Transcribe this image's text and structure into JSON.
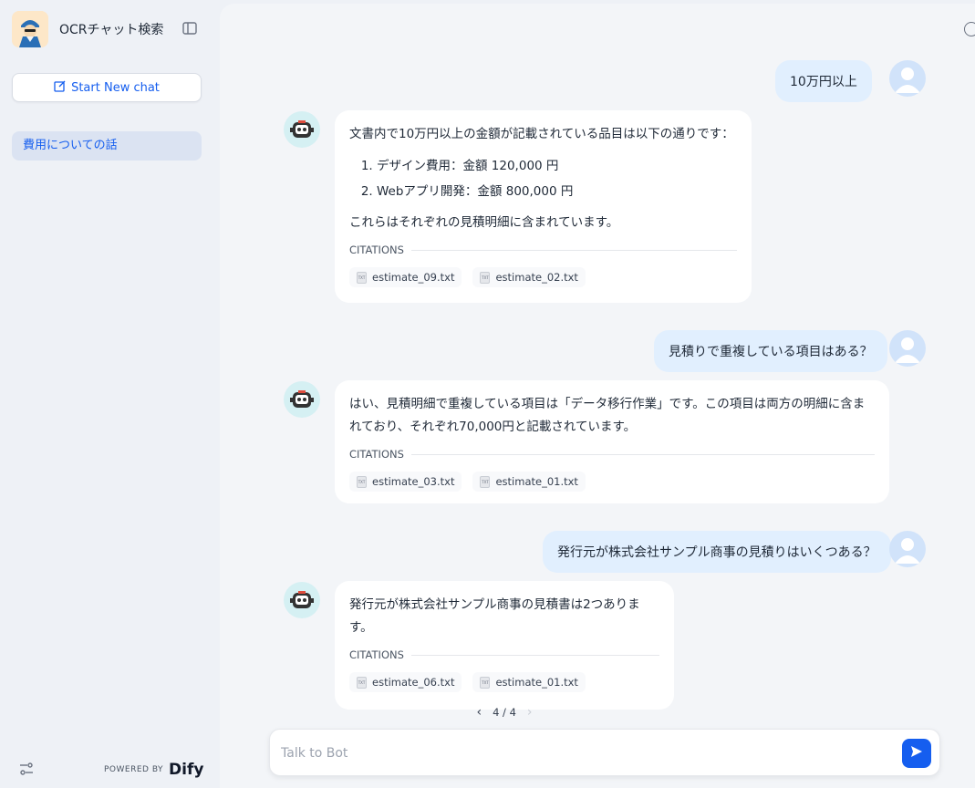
{
  "app": {
    "title": "OCRチャット検索",
    "new_chat_label": "Start New chat",
    "powered_by_label": "POWERED BY",
    "brand": "Dify"
  },
  "sidebar": {
    "conversations": [
      {
        "label": "費用についての話"
      }
    ]
  },
  "messages": [
    {
      "role": "user",
      "text": "10万円以上"
    },
    {
      "role": "bot",
      "intro": "文書内で10万円以上の金額が記載されている品目は以下の通りです：",
      "list": [
        "デザイン費用：金額 120,000 円",
        "Webアプリ開発：金額 800,000 円"
      ],
      "outro": "これらはそれぞれの見積明細に含まれています。",
      "citations_label": "CITATIONS",
      "citations": [
        "estimate_09.txt",
        "estimate_02.txt"
      ]
    },
    {
      "role": "user",
      "text": "見積りで重複している項目はある？"
    },
    {
      "role": "bot",
      "intro": "はい、見積明細で重複している項目は「データ移行作業」です。この項目は両方の明細に含まれており、それぞれ70,000円と記載されています。",
      "citations_label": "CITATIONS",
      "citations": [
        "estimate_03.txt",
        "estimate_01.txt"
      ]
    },
    {
      "role": "user",
      "text": "発行元が株式会社サンプル商事の見積りはいくつある？"
    },
    {
      "role": "bot",
      "intro": "発行元が株式会社サンプル商事の見積書は2つあります。",
      "citations_label": "CITATIONS",
      "citations": [
        "estimate_06.txt",
        "estimate_01.txt"
      ],
      "pagination": "4 / 4"
    }
  ],
  "input": {
    "placeholder": "Talk to Bot",
    "value": ""
  },
  "colors": {
    "accent": "#155eef",
    "user_bubble": "#e1effe",
    "sidebar_bg": "#eef1f6"
  }
}
